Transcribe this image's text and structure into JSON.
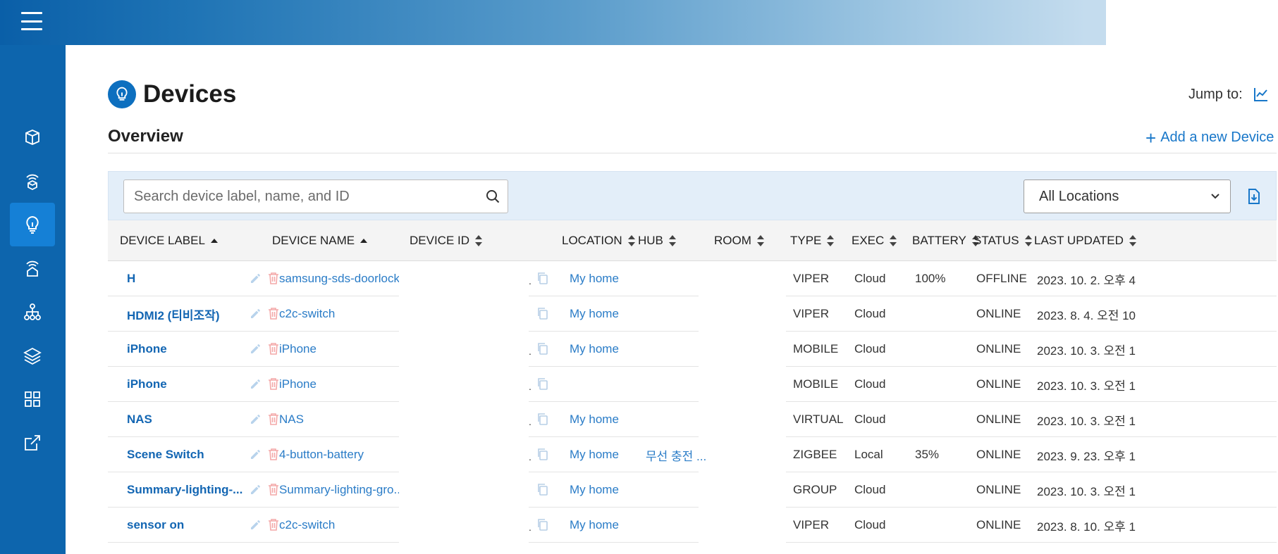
{
  "header": {
    "menu_icon": "hamburger-menu-icon"
  },
  "sidebar": {
    "items": [
      {
        "name": "box-icon"
      },
      {
        "name": "broadcast-cube-icon"
      },
      {
        "name": "lightbulb-icon",
        "active": true
      },
      {
        "name": "broadcast-home-icon"
      },
      {
        "name": "network-icon"
      },
      {
        "name": "layers-icon"
      },
      {
        "name": "dashboard-icon"
      },
      {
        "name": "external-link-icon"
      }
    ]
  },
  "page": {
    "title": "Devices",
    "jump_label": "Jump to:",
    "section_title": "Overview",
    "add_device_label": "Add a new Device"
  },
  "filters": {
    "search_placeholder": "Search device label, name, and ID",
    "location_selected": "All Locations"
  },
  "table": {
    "columns": [
      "DEVICE LABEL",
      "DEVICE NAME",
      "DEVICE ID",
      "LOCATION",
      "HUB",
      "ROOM",
      "TYPE",
      "EXEC",
      "BATTERY",
      "STATUS",
      "LAST UPDATED"
    ],
    "rows": [
      {
        "label": "H",
        "name": "samsung-sds-doorlock...",
        "dot": ".",
        "location": "My home",
        "hub": "",
        "type": "VIPER",
        "exec": "Cloud",
        "battery": "100%",
        "status": "OFFLINE",
        "updated": "2023. 10. 2. 오후 4"
      },
      {
        "label": "HDMI2 (티비조작)",
        "name": "c2c-switch",
        "dot": "",
        "location": "My home",
        "hub": "",
        "type": "VIPER",
        "exec": "Cloud",
        "battery": "",
        "status": "ONLINE",
        "updated": "2023. 8. 4. 오전 10"
      },
      {
        "label": "iPhone",
        "name": "iPhone",
        "dot": ".",
        "location": "My home",
        "hub": "",
        "type": "MOBILE",
        "exec": "Cloud",
        "battery": "",
        "status": "ONLINE",
        "updated": "2023. 10. 3. 오전 1"
      },
      {
        "label": "iPhone",
        "name": "iPhone",
        "dot": ".",
        "location": "",
        "hub": "",
        "type": "MOBILE",
        "exec": "Cloud",
        "battery": "",
        "status": "ONLINE",
        "updated": "2023. 10. 3. 오전 1"
      },
      {
        "label": "NAS",
        "name": "NAS",
        "dot": ".",
        "location": "My home",
        "hub": "",
        "type": "VIRTUAL",
        "exec": "Cloud",
        "battery": "",
        "status": "ONLINE",
        "updated": "2023. 10. 3. 오전 1"
      },
      {
        "label": "Scene Switch",
        "name": "4-button-battery",
        "dot": ".",
        "location": "My home",
        "hub": "무선 충전 ...",
        "type": "ZIGBEE",
        "exec": "Local",
        "battery": "35%",
        "status": "ONLINE",
        "updated": "2023. 9. 23. 오후 1"
      },
      {
        "label": "Summary-lighting-...",
        "name": "Summary-lighting-gro...",
        "dot": "",
        "location": "My home",
        "hub": "",
        "type": "GROUP",
        "exec": "Cloud",
        "battery": "",
        "status": "ONLINE",
        "updated": "2023. 10. 3. 오전 1"
      },
      {
        "label": "sensor on",
        "name": "c2c-switch",
        "dot": ".",
        "location": "My home",
        "hub": "",
        "type": "VIPER",
        "exec": "Cloud",
        "battery": "",
        "status": "ONLINE",
        "updated": "2023. 8. 10. 오후 1"
      }
    ]
  },
  "colors": {
    "sidebar": "#0d65ad",
    "active_nav": "#1580d6",
    "link": "#2a7cc7",
    "delete": "#f08a8a"
  }
}
